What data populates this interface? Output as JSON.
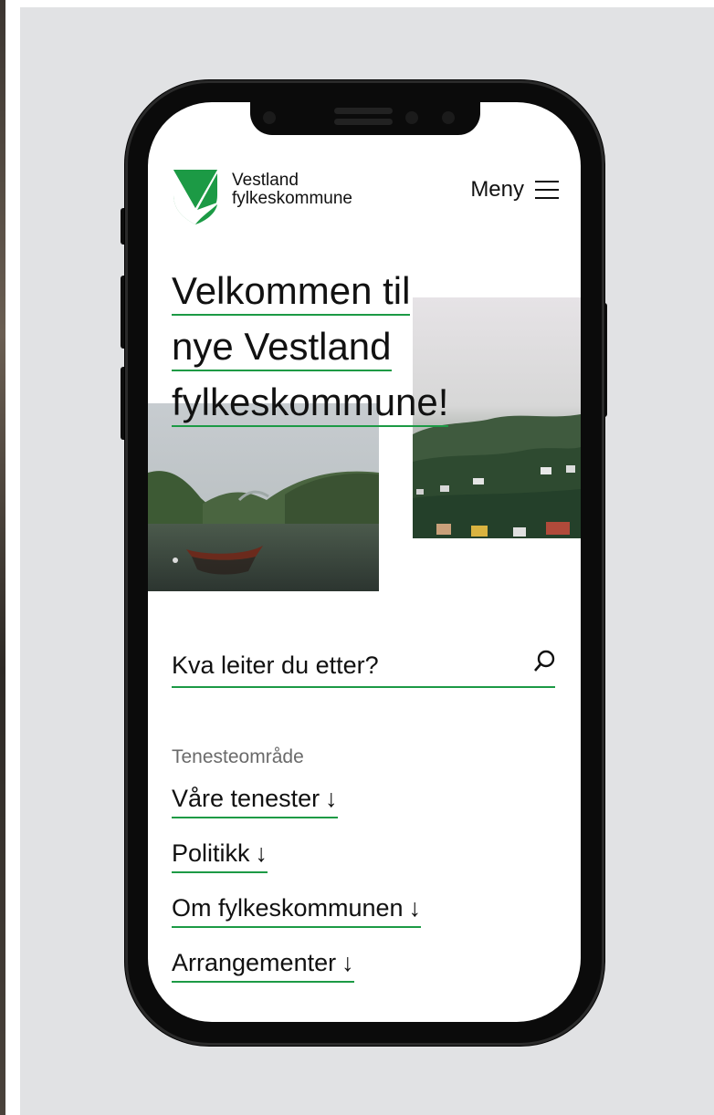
{
  "brand": {
    "line1": "Vestland",
    "line2": "fylkeskommune",
    "logo_icon": "vestland-shield-logo-icon",
    "accent_color": "#1c9a45"
  },
  "header": {
    "menu_label": "Meny",
    "menu_icon": "hamburger-icon"
  },
  "hero": {
    "line1": "Velkommen til",
    "line2": "nye Vestland",
    "line3": "fylkeskommune!"
  },
  "images": {
    "left": "fjord-boat-photo",
    "right": "misty-hillside-village-photo"
  },
  "search": {
    "placeholder": "Kva leiter du etter?",
    "icon": "search-icon"
  },
  "services": {
    "label": "Tenesteområde",
    "arrow": "↓",
    "links": [
      "Våre tenester",
      "Politikk",
      "Om fylkeskommunen",
      "Arrangementer"
    ]
  }
}
